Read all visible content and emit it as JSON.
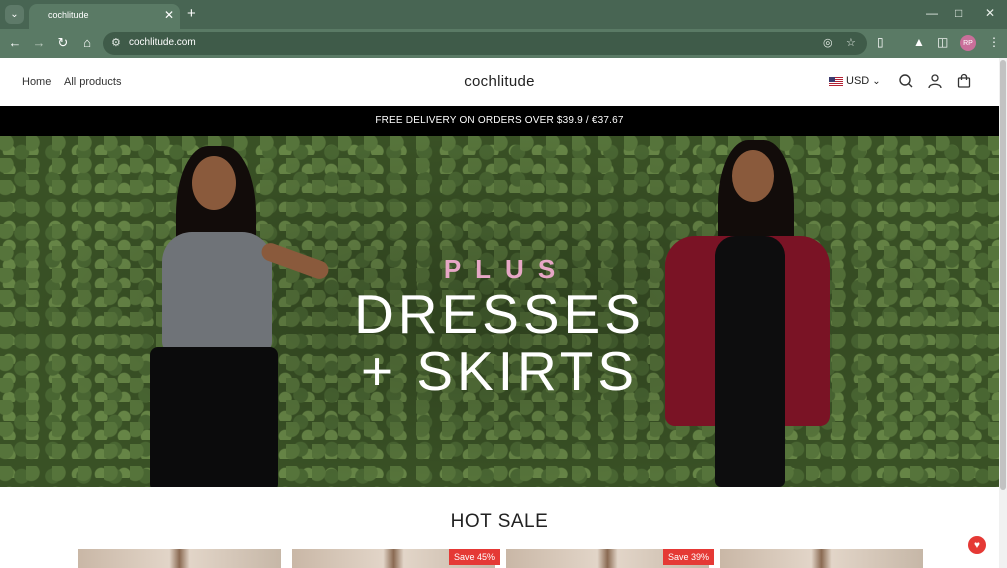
{
  "browser": {
    "tab_title": "cochlitude",
    "url": "cochlitude.com",
    "avatar_initials": "RP"
  },
  "site": {
    "nav": [
      "Home",
      "All products"
    ],
    "brand": "cochlitude",
    "currency": "USD"
  },
  "announcement": "FREE DELIVERY ON ORDERS OVER $39.9 / €37.67",
  "hero": {
    "plus": "PLUS",
    "line1": "DRESSES",
    "line2": "+ SKIRTS"
  },
  "hot_sale": {
    "title": "HOT SALE",
    "badges": [
      "Save 45%",
      "Save 39%"
    ]
  },
  "colors": {
    "browser_frame": "#486553",
    "sale_badge": "#e53935",
    "hero_accent": "#e7a7c6"
  }
}
